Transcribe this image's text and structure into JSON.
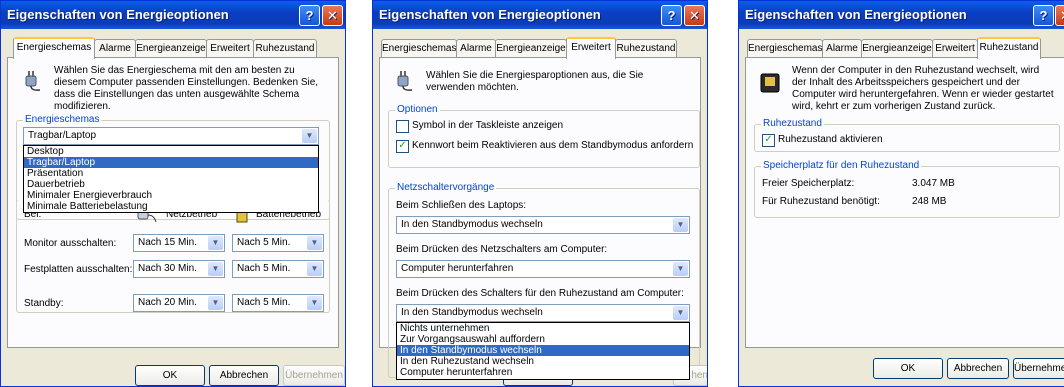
{
  "windows": [
    {
      "title": "Eigenschaften von Energieoptionen",
      "tabs": [
        "Energieschemas",
        "Alarme",
        "Energieanzeige",
        "Erweitert",
        "Ruhezustand"
      ],
      "active_tab": "Energieschemas",
      "intro": "Wählen Sie das Energieschema mit den am besten zu diesem Computer passenden Einstellungen. Bedenken Sie, dass die Einstellungen das unten ausgewählte Schema modifizieren.",
      "group_label": "Energieschemas",
      "scheme_value": "Tragbar/Laptop",
      "scheme_options": [
        "Desktop",
        "Tragbar/Laptop",
        "Präsentation",
        "Dauerbetrieb",
        "Minimaler Energieverbrauch",
        "Minimale Batteriebelastung"
      ],
      "scheme_selected": "Tragbar/Laptop",
      "bei_label": "Bei:",
      "netzbetrieb": "Netzbetrieb",
      "batteriebetrieb": "Batteriebetrieb",
      "rows": [
        {
          "label": "Monitor ausschalten:",
          "ac": "Nach 15 Min.",
          "dc": "Nach 5 Min."
        },
        {
          "label": "Festplatten ausschalten:",
          "ac": "Nach 30 Min.",
          "dc": "Nach 5 Min."
        },
        {
          "label": "Standby:",
          "ac": "Nach 20 Min.",
          "dc": "Nach 5 Min."
        }
      ],
      "buttons": {
        "ok": "OK",
        "cancel": "Abbrechen",
        "apply": "Übernehmen"
      }
    },
    {
      "title": "Eigenschaften von Energieoptionen",
      "tabs": [
        "Energieschemas",
        "Alarme",
        "Energieanzeige",
        "Erweitert",
        "Ruhezustand"
      ],
      "active_tab": "Erweitert",
      "intro": "Wählen Sie die Energiesparoptionen aus, die Sie verwenden möchten.",
      "options_label": "Optionen",
      "options": [
        {
          "label": "Symbol in der Taskleiste anzeigen",
          "checked": false
        },
        {
          "label": "Kennwort beim Reaktivieren aus dem Standbymodus anfordern",
          "checked": true
        }
      ],
      "switch_label": "Netzschaltervorgänge",
      "switch_items": [
        {
          "label": "Beim Schließen des Laptops:",
          "value": "In den Standbymodus wechseln"
        },
        {
          "label": "Beim Drücken des Netzschalters am Computer:",
          "value": "Computer herunterfahren"
        },
        {
          "label": "Beim Drücken des Schalters für den Ruhezustand am Computer:",
          "value": "In den Standbymodus wechseln"
        }
      ],
      "dropdown_options": [
        "Nichts unternehmen",
        "Zur Vorgangsauswahl auffordern",
        "In den Standbymodus wechseln",
        "In den Ruhezustand wechseln",
        "Computer herunterfahren"
      ],
      "dropdown_selected": "In den Standbymodus wechseln",
      "partial_apply": "hen"
    },
    {
      "title": "Eigenschaften von Energieoptionen",
      "tabs": [
        "Energieschemas",
        "Alarme",
        "Energieanzeige",
        "Erweitert",
        "Ruhezustand"
      ],
      "active_tab": "Ruhezustand",
      "intro": "Wenn der Computer in den Ruhezustand wechselt, wird der Inhalt des Arbeitsspeichers gespeichert und der Computer wird heruntergefahren. Wenn er wieder gestartet wird, kehrt er zum vorherigen Zustand zurück.",
      "hib_label": "Ruhezustand",
      "hib_checkbox": "Ruhezustand aktivieren",
      "hib_checked": true,
      "space_label": "Speicherplatz für den Ruhezustand",
      "free_label": "Freier Speicherplatz:",
      "free_value": "3.047 MB",
      "need_label": "Für Ruhezustand benötigt:",
      "need_value": "248 MB",
      "buttons": {
        "ok": "OK",
        "cancel": "Abbrechen",
        "apply": "Übernehmen"
      }
    }
  ]
}
